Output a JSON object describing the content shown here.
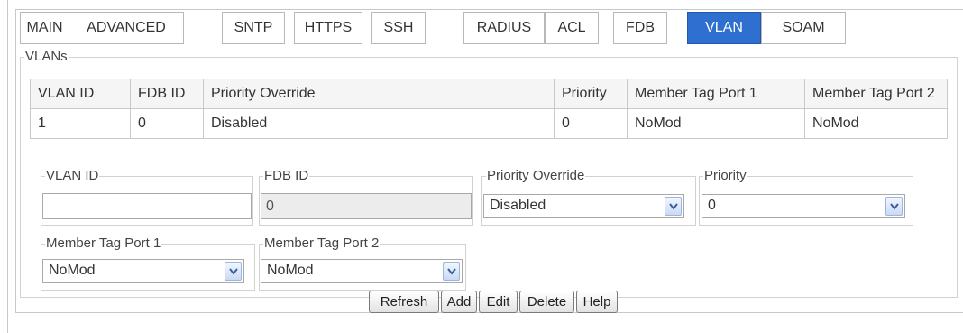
{
  "tabs": [
    {
      "label": "MAIN"
    },
    {
      "label": "ADVANCED"
    },
    {
      "label": "SNTP"
    },
    {
      "label": "HTTPS"
    },
    {
      "label": "SSH"
    },
    {
      "label": "RADIUS"
    },
    {
      "label": "ACL"
    },
    {
      "label": "FDB"
    },
    {
      "label": "VLAN"
    },
    {
      "label": "SOAM"
    }
  ],
  "active_tab": "VLAN",
  "vlans_group": {
    "legend": "VLANs"
  },
  "table": {
    "headers": [
      "VLAN ID",
      "FDB ID",
      "Priority Override",
      "Priority",
      "Member Tag Port 1",
      "Member Tag Port 2"
    ],
    "rows": [
      [
        "1",
        "0",
        "Disabled",
        "0",
        "NoMod",
        "NoMod"
      ]
    ]
  },
  "form": {
    "vlan_id": {
      "label": "VLAN ID",
      "value": ""
    },
    "fdb_id": {
      "label": "FDB ID",
      "value": "0"
    },
    "priority_override": {
      "label": "Priority Override",
      "value": "Disabled"
    },
    "priority": {
      "label": "Priority",
      "value": "0"
    },
    "member_tag_port_1": {
      "label": "Member Tag Port 1",
      "value": "NoMod"
    },
    "member_tag_port_2": {
      "label": "Member Tag Port 2",
      "value": "NoMod"
    }
  },
  "buttons": {
    "refresh": "Refresh",
    "add": "Add",
    "edit": "Edit",
    "delete": "Delete",
    "help": "Help"
  },
  "colors": {
    "active_tab": "#2e6fd0",
    "border": "#c8c8c8"
  }
}
